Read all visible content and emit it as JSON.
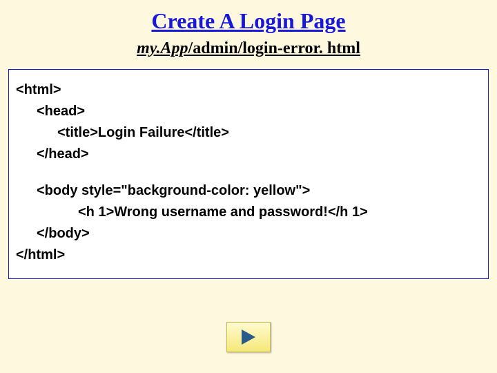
{
  "title": "Create A Login Page",
  "subtitle_italic": "my.App",
  "subtitle_rest": "/admin/login-error. html",
  "code": {
    "line1": "<html>",
    "line2": "<head>",
    "line3": "<title>Login Failure</title>",
    "line4": "</head>",
    "line5": "<body style=\"background-color: yellow\">",
    "line6": "<h 1>Wrong username and password!</h 1>",
    "line7": "</body>",
    "line8": "</html>"
  }
}
